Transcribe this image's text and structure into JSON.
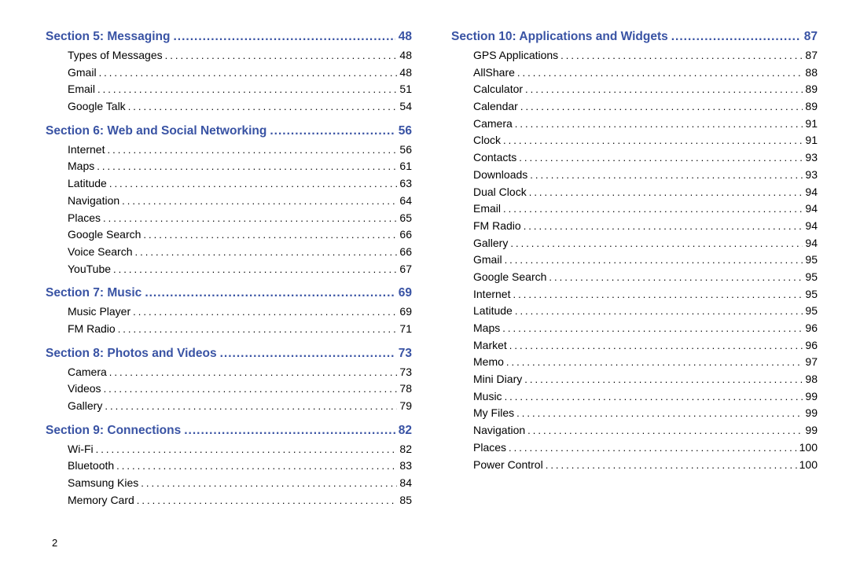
{
  "page_number": "2",
  "columns": [
    {
      "sections": [
        {
          "title": "Section 5:  Messaging",
          "page": "48",
          "entries": [
            {
              "title": "Types of Messages",
              "page": "48"
            },
            {
              "title": "Gmail",
              "page": "48"
            },
            {
              "title": "Email",
              "page": "51"
            },
            {
              "title": "Google Talk",
              "page": "54"
            }
          ]
        },
        {
          "title": "Section 6:  Web and Social Networking",
          "page": "56",
          "entries": [
            {
              "title": "Internet",
              "page": "56"
            },
            {
              "title": "Maps",
              "page": "61"
            },
            {
              "title": "Latitude",
              "page": "63"
            },
            {
              "title": "Navigation",
              "page": "64"
            },
            {
              "title": "Places",
              "page": "65"
            },
            {
              "title": "Google Search",
              "page": "66"
            },
            {
              "title": "Voice Search",
              "page": "66"
            },
            {
              "title": "YouTube",
              "page": "67"
            }
          ]
        },
        {
          "title": "Section 7:  Music",
          "page": "69",
          "entries": [
            {
              "title": "Music Player",
              "page": "69"
            },
            {
              "title": "FM Radio",
              "page": "71"
            }
          ]
        },
        {
          "title": "Section 8:  Photos and Videos",
          "page": "73",
          "entries": [
            {
              "title": "Camera",
              "page": "73"
            },
            {
              "title": "Videos",
              "page": "78"
            },
            {
              "title": "Gallery",
              "page": "79"
            }
          ]
        },
        {
          "title": "Section 9:  Connections",
          "page": "82",
          "entries": [
            {
              "title": "Wi-Fi",
              "page": "82"
            },
            {
              "title": "Bluetooth",
              "page": "83"
            },
            {
              "title": "Samsung Kies",
              "page": "84"
            },
            {
              "title": "Memory Card",
              "page": "85"
            }
          ]
        }
      ]
    },
    {
      "sections": [
        {
          "title": "Section 10:  Applications and Widgets",
          "page": "87",
          "entries": [
            {
              "title": "GPS Applications",
              "page": "87"
            },
            {
              "title": "AllShare",
              "page": "88"
            },
            {
              "title": "Calculator",
              "page": "89"
            },
            {
              "title": "Calendar",
              "page": "89"
            },
            {
              "title": "Camera",
              "page": "91"
            },
            {
              "title": "Clock",
              "page": "91"
            },
            {
              "title": "Contacts",
              "page": "93"
            },
            {
              "title": "Downloads",
              "page": "93"
            },
            {
              "title": "Dual Clock",
              "page": "94"
            },
            {
              "title": "Email",
              "page": "94"
            },
            {
              "title": "FM Radio",
              "page": "94"
            },
            {
              "title": "Gallery",
              "page": "94"
            },
            {
              "title": "Gmail",
              "page": "95"
            },
            {
              "title": "Google Search",
              "page": "95"
            },
            {
              "title": "Internet",
              "page": "95"
            },
            {
              "title": "Latitude",
              "page": "95"
            },
            {
              "title": "Maps",
              "page": "96"
            },
            {
              "title": "Market",
              "page": "96"
            },
            {
              "title": "Memo",
              "page": "97"
            },
            {
              "title": "Mini Diary",
              "page": "98"
            },
            {
              "title": "Music",
              "page": "99"
            },
            {
              "title": "My Files",
              "page": "99"
            },
            {
              "title": "Navigation",
              "page": "99"
            },
            {
              "title": "Places",
              "page": "100"
            },
            {
              "title": "Power Control",
              "page": "100"
            }
          ]
        }
      ]
    }
  ]
}
